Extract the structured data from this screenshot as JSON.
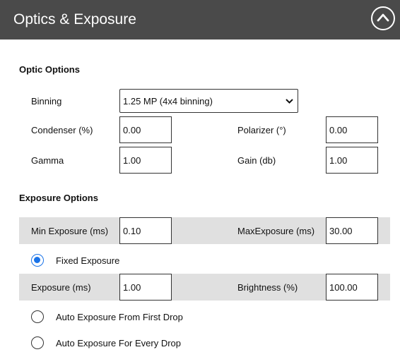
{
  "header": {
    "title": "Optics & Exposure",
    "collapse_icon": "chevron-up-icon"
  },
  "optic_options": {
    "title": "Optic Options",
    "binning": {
      "label": "Binning",
      "value": "1.25 MP (4x4 binning)"
    },
    "condenser": {
      "label": "Condenser (%)",
      "value": "0.00"
    },
    "polarizer": {
      "label": "Polarizer (°)",
      "value": "0.00"
    },
    "gamma": {
      "label": "Gamma",
      "value": "1.00"
    },
    "gain": {
      "label": "Gain (db)",
      "value": "1.00"
    }
  },
  "exposure_options": {
    "title": "Exposure Options",
    "min_exposure": {
      "label": "Min Exposure (ms)",
      "value": "0.10"
    },
    "max_exposure": {
      "label": "MaxExposure (ms)",
      "value": "30.00"
    },
    "fixed_exposure": {
      "label": "Fixed Exposure",
      "selected": true
    },
    "exposure": {
      "label": "Exposure (ms)",
      "value": "1.00"
    },
    "brightness": {
      "label": "Brightness (%)",
      "value": "100.00"
    },
    "auto_first": {
      "label": "Auto Exposure From First Drop",
      "selected": false
    },
    "auto_every": {
      "label": "Auto Exposure For Every Drop",
      "selected": false
    }
  },
  "colors": {
    "header_bg": "#4a4a4a",
    "band_bg": "#e0e0e0",
    "radio_accent": "#1a73e8"
  }
}
